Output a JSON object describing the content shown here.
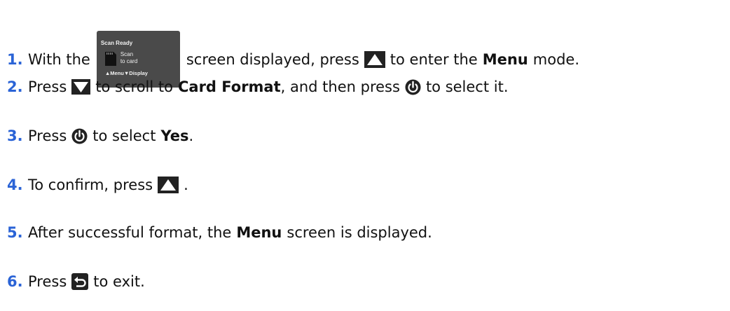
{
  "steps": [
    {
      "num": "1.",
      "t1": "With the",
      "t2": "screen displayed, press",
      "t3": "to enter the",
      "bold": "Menu",
      "t4": "mode.",
      "screen": {
        "title": "Scan Ready",
        "label_line1": "Scan",
        "label_line2": "to card",
        "left_key": "Menu",
        "right_key": "Display"
      }
    },
    {
      "num": "2.",
      "t1": "Press",
      "t2": "to scroll to",
      "bold": "Card Format",
      "t3": ", and then press",
      "t4": "to select it."
    },
    {
      "num": "3.",
      "t1": "Press",
      "t2": "to select",
      "bold": "Yes",
      "t3": "."
    },
    {
      "num": "4.",
      "t1": "To confirm, press",
      "t2": "."
    },
    {
      "num": "5.",
      "t1": "After successful format, the",
      "bold": "Menu",
      "t2": "screen is displayed."
    },
    {
      "num": "6.",
      "t1": "Press",
      "t2": "to exit."
    }
  ],
  "icons": {
    "up": "up-triangle-button-icon",
    "down": "down-triangle-button-icon",
    "power": "power-select-icon",
    "back": "return-back-icon",
    "card": "sd-card-icon"
  },
  "colors": {
    "step_number": "#2a63d6",
    "screen_background": "#4a4a4a",
    "icon_fill": "#222222"
  }
}
